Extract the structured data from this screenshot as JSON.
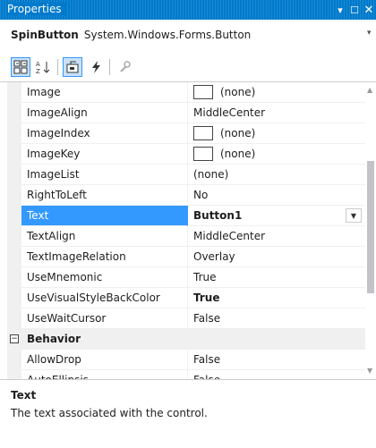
{
  "window": {
    "title": "Properties"
  },
  "object": {
    "name": "SpinButton",
    "type": "System.Windows.Forms.Button"
  },
  "toolbar": {
    "buttons": [
      {
        "icon": "categorized-icon",
        "active": true
      },
      {
        "icon": "alphabetical-icon"
      },
      {
        "icon": "properties-icon",
        "active": true
      },
      {
        "icon": "events-icon"
      },
      {
        "icon": "property-pages-icon"
      }
    ]
  },
  "rows": [
    {
      "name": "Image",
      "value": "(none)",
      "swatch": true
    },
    {
      "name": "ImageAlign",
      "value": "MiddleCenter"
    },
    {
      "name": "ImageIndex",
      "value": "(none)",
      "swatch": true
    },
    {
      "name": "ImageKey",
      "value": "(none)",
      "swatch": true
    },
    {
      "name": "ImageList",
      "value": "(none)"
    },
    {
      "name": "RightToLeft",
      "value": "No"
    },
    {
      "name": "Text",
      "value": "Button1",
      "selected": true
    },
    {
      "name": "TextAlign",
      "value": "MiddleCenter"
    },
    {
      "name": "TextImageRelation",
      "value": "Overlay"
    },
    {
      "name": "UseMnemonic",
      "value": "True"
    },
    {
      "name": "UseVisualStyleBackColor",
      "value": "True",
      "bold": true
    },
    {
      "name": "UseWaitCursor",
      "value": "False"
    }
  ],
  "category": {
    "name": "Behavior"
  },
  "behavior_rows": [
    {
      "name": "AllowDrop",
      "value": "False"
    },
    {
      "name": "AutoEllipsis",
      "value": "False"
    }
  ],
  "description": {
    "title": "Text",
    "text": "The text associated with the control."
  },
  "colors": {
    "titlebar": "#007acc",
    "selection": "#3399ff",
    "gutter": "#f0f0f0"
  }
}
